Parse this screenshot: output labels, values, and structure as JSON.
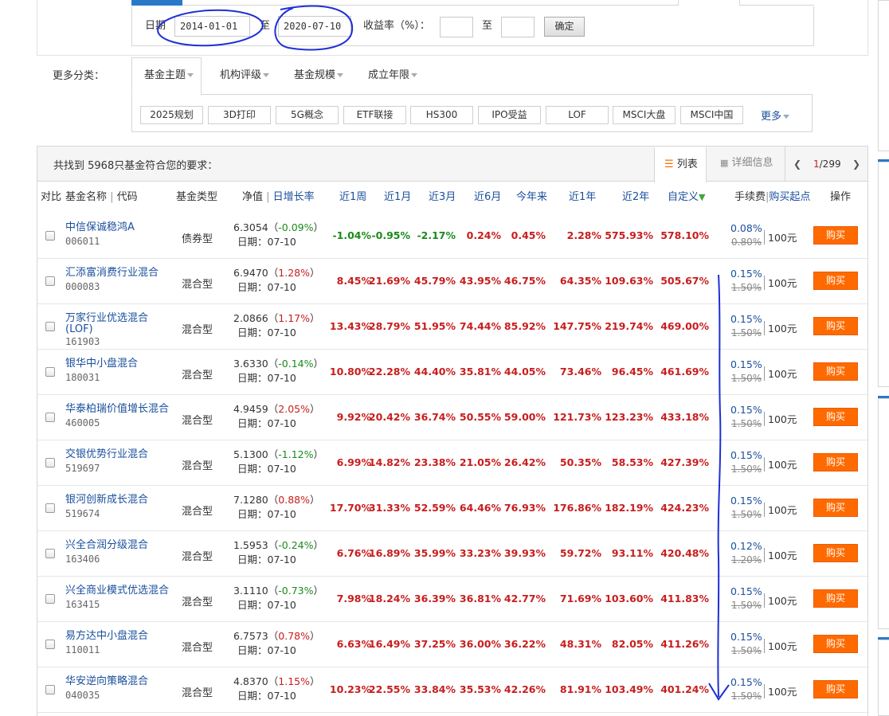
{
  "filters": {
    "date_label": "日期",
    "date_from": "2014-01-01",
    "to_label": "至",
    "date_to": "2020-07-10",
    "yield_label": "收益率（%）：",
    "yield_from": "",
    "yield_to_label": "至",
    "yield_to": "",
    "confirm_label": "确定"
  },
  "more_categories": {
    "label": "更多分类：",
    "tabs": [
      "基金主题",
      "机构评级",
      "基金规模",
      "成立年限"
    ],
    "tags": [
      "2025规划",
      "3D打印",
      "5G概念",
      "ETF联接",
      "HS300",
      "IPO受益",
      "LOF",
      "MSCI大盘",
      "MSCI中国"
    ],
    "more_label": "更多"
  },
  "results": {
    "found_text": "共找到 5968只基金符合您的要求：",
    "view_list": "列表",
    "view_detail": "详细信息",
    "page_current": "1",
    "page_total": "/299"
  },
  "table": {
    "headers": {
      "compare": "对比",
      "name": "基金名称",
      "code": "代码",
      "type": "基金类型",
      "nav": "净值",
      "daily": "日增长率",
      "w1": "近1周",
      "m1": "近1月",
      "m3": "近3月",
      "m6": "近6月",
      "ytd": "今年来",
      "y1": "近1年",
      "y2": "近2年",
      "custom": "自定义",
      "fee": "手续费",
      "min_buy": "购买起点",
      "action": "操作"
    },
    "rows": [
      {
        "name": "中信保诚稳鸿A",
        "code": "006011",
        "type": "债券型",
        "nav": "6.3054",
        "daily": "-0.09%",
        "daily_dir": "down",
        "date": "日期：07-10",
        "w1": "-1.04%",
        "m1": "-0.95%",
        "m3": "-2.17%",
        "m6": "0.24%",
        "ytd": "0.45%",
        "y1": "2.28%",
        "y2": "575.93%",
        "custom": "578.10%",
        "fee_new": "0.08%",
        "fee_old": "0.80%",
        "min_buy": "100元",
        "buy": "购买"
      },
      {
        "name": "汇添富消费行业混合",
        "code": "000083",
        "type": "混合型",
        "nav": "6.9470",
        "daily": "1.28%",
        "daily_dir": "up",
        "date": "日期：07-10",
        "w1": "8.45%",
        "m1": "21.69%",
        "m3": "45.79%",
        "m6": "43.95%",
        "ytd": "46.75%",
        "y1": "64.35%",
        "y2": "109.63%",
        "custom": "505.67%",
        "fee_new": "0.15%",
        "fee_old": "1.50%",
        "min_buy": "100元",
        "buy": "购买"
      },
      {
        "name": "万家行业优选混合",
        "name2": "(LOF)",
        "code": "161903",
        "type": "混合型",
        "nav": "2.0866",
        "daily": "1.17%",
        "daily_dir": "up",
        "date": "日期：07-10",
        "w1": "13.43%",
        "m1": "28.79%",
        "m3": "51.95%",
        "m6": "74.44%",
        "ytd": "85.92%",
        "y1": "147.75%",
        "y2": "219.74%",
        "custom": "469.00%",
        "fee_new": "0.15%",
        "fee_old": "1.50%",
        "min_buy": "100元",
        "buy": "购买"
      },
      {
        "name": "银华中小盘混合",
        "code": "180031",
        "type": "混合型",
        "nav": "3.6330",
        "daily": "-0.14%",
        "daily_dir": "down",
        "date": "日期：07-10",
        "w1": "10.80%",
        "m1": "22.28%",
        "m3": "44.40%",
        "m6": "35.81%",
        "ytd": "44.05%",
        "y1": "73.46%",
        "y2": "96.45%",
        "custom": "461.69%",
        "fee_new": "0.15%",
        "fee_old": "1.50%",
        "min_buy": "100元",
        "buy": "购买"
      },
      {
        "name": "华泰柏瑞价值增长混合",
        "code": "460005",
        "type": "混合型",
        "nav": "4.9459",
        "daily": "2.05%",
        "daily_dir": "up",
        "date": "日期：07-10",
        "w1": "9.92%",
        "m1": "20.42%",
        "m3": "36.74%",
        "m6": "50.55%",
        "ytd": "59.00%",
        "y1": "121.73%",
        "y2": "123.23%",
        "custom": "433.18%",
        "fee_new": "0.15%",
        "fee_old": "1.50%",
        "min_buy": "100元",
        "buy": "购买"
      },
      {
        "name": "交银优势行业混合",
        "code": "519697",
        "type": "混合型",
        "nav": "5.1300",
        "daily": "-1.12%",
        "daily_dir": "down",
        "date": "日期：07-10",
        "w1": "6.99%",
        "m1": "14.82%",
        "m3": "23.38%",
        "m6": "21.05%",
        "ytd": "26.42%",
        "y1": "50.35%",
        "y2": "58.53%",
        "custom": "427.39%",
        "fee_new": "0.15%",
        "fee_old": "1.50%",
        "min_buy": "100元",
        "buy": "购买"
      },
      {
        "name": "银河创新成长混合",
        "code": "519674",
        "type": "混合型",
        "nav": "7.1280",
        "daily": "0.88%",
        "daily_dir": "up",
        "date": "日期：07-10",
        "w1": "17.70%",
        "m1": "31.33%",
        "m3": "52.59%",
        "m6": "64.46%",
        "ytd": "76.93%",
        "y1": "176.86%",
        "y2": "182.19%",
        "custom": "424.23%",
        "fee_new": "0.15%",
        "fee_old": "1.50%",
        "min_buy": "100元",
        "buy": "购买"
      },
      {
        "name": "兴全合润分级混合",
        "code": "163406",
        "type": "混合型",
        "nav": "1.5953",
        "daily": "-0.24%",
        "daily_dir": "down",
        "date": "日期：07-10",
        "w1": "6.76%",
        "m1": "16.89%",
        "m3": "35.99%",
        "m6": "33.23%",
        "ytd": "39.93%",
        "y1": "59.72%",
        "y2": "93.11%",
        "custom": "420.48%",
        "fee_new": "0.12%",
        "fee_old": "1.20%",
        "min_buy": "100元",
        "buy": "购买"
      },
      {
        "name": "兴全商业模式优选混合",
        "code": "163415",
        "type": "混合型",
        "nav": "3.1110",
        "daily": "-0.73%",
        "daily_dir": "down",
        "date": "日期：07-10",
        "w1": "7.98%",
        "m1": "18.24%",
        "m3": "36.39%",
        "m6": "36.81%",
        "ytd": "42.77%",
        "y1": "71.69%",
        "y2": "103.60%",
        "custom": "411.83%",
        "fee_new": "0.15%",
        "fee_old": "1.50%",
        "min_buy": "100元",
        "buy": "购买"
      },
      {
        "name": "易方达中小盘混合",
        "code": "110011",
        "type": "混合型",
        "nav": "6.7573",
        "daily": "0.78%",
        "daily_dir": "up",
        "date": "日期：07-10",
        "w1": "6.63%",
        "m1": "16.49%",
        "m3": "37.25%",
        "m6": "36.00%",
        "ytd": "36.22%",
        "y1": "48.31%",
        "y2": "82.05%",
        "custom": "411.26%",
        "fee_new": "0.15%",
        "fee_old": "1.50%",
        "min_buy": "100元",
        "buy": "购买"
      },
      {
        "name": "华安逆向策略混合",
        "code": "040035",
        "type": "混合型",
        "nav": "4.8370",
        "daily": "1.15%",
        "daily_dir": "up",
        "date": "日期：07-10",
        "w1": "10.23%",
        "m1": "22.55%",
        "m3": "33.84%",
        "m6": "35.53%",
        "ytd": "42.26%",
        "y1": "81.91%",
        "y2": "103.49%",
        "custom": "401.24%",
        "fee_new": "0.15%",
        "fee_old": "1.50%",
        "min_buy": "100元",
        "buy": "购买"
      }
    ]
  },
  "colors": {
    "up": "#c81d1d",
    "down": "#1a8a1a",
    "link": "#1a4f9c",
    "buy_button": "#ff6a00",
    "annotation_ink": "#1f2fd6"
  }
}
